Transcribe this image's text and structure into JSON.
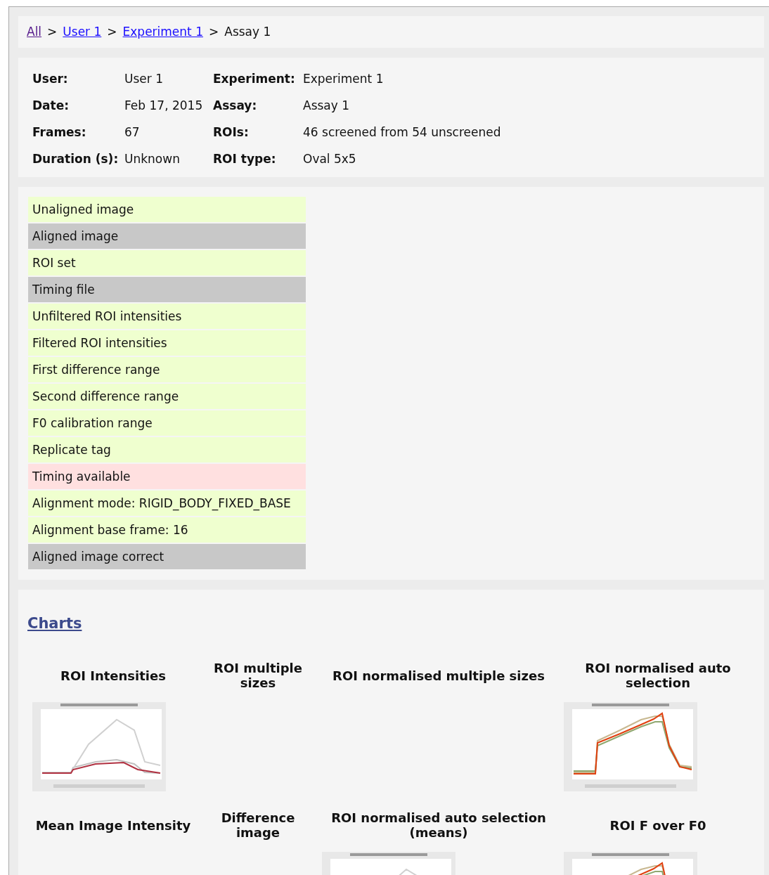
{
  "breadcrumb": [
    {
      "label": "All",
      "kind": "visited"
    },
    {
      "label": "User 1",
      "kind": "link"
    },
    {
      "label": "Experiment 1",
      "kind": "link"
    },
    {
      "label": "Assay 1",
      "kind": "current"
    }
  ],
  "breadcrumb_separator": ">",
  "info": [
    {
      "label": "User:",
      "value": "User 1"
    },
    {
      "label": "Experiment:",
      "value": "Experiment 1"
    },
    {
      "label": "Date:",
      "value": "Feb 17, 2015"
    },
    {
      "label": "Assay:",
      "value": "Assay 1"
    },
    {
      "label": "Frames:",
      "value": "67"
    },
    {
      "label": "ROIs:",
      "value": "46 screened from 54 unscreened"
    },
    {
      "label": "Duration (s):",
      "value": "Unknown"
    },
    {
      "label": "ROI type:",
      "value": "Oval 5x5"
    }
  ],
  "files": [
    {
      "label": "Unaligned image",
      "color": "#efffcf"
    },
    {
      "label": "Aligned image",
      "color": "#c8c8c8"
    },
    {
      "label": "ROI set",
      "color": "#efffcf"
    },
    {
      "label": "Timing file",
      "color": "#c8c8c8"
    },
    {
      "label": "Unfiltered ROI intensities",
      "color": "#efffcf"
    },
    {
      "label": "Filtered ROI intensities",
      "color": "#efffcf"
    },
    {
      "label": "First difference range",
      "color": "#efffcf"
    },
    {
      "label": "Second difference range",
      "color": "#efffcf"
    },
    {
      "label": "F0 calibration range",
      "color": "#efffcf"
    },
    {
      "label": "Replicate tag",
      "color": "#efffcf"
    },
    {
      "label": "Timing available",
      "color": "#ffe0e0"
    },
    {
      "label": "Alignment mode: RIGID_BODY_FIXED_BASE",
      "color": "#efffcf"
    },
    {
      "label": "Alignment base frame: 16",
      "color": "#efffcf"
    },
    {
      "label": "Aligned image correct",
      "color": "#c8c8c8"
    }
  ],
  "charts": {
    "heading": "Charts",
    "items": [
      {
        "title": "ROI Intensities"
      },
      {
        "title": "ROI multiple sizes"
      },
      {
        "title": "ROI normalised multiple sizes"
      },
      {
        "title": "ROI normalised auto selection"
      },
      {
        "title": "Mean Image Intensity"
      },
      {
        "title": "Difference image"
      },
      {
        "title": "ROI normalised auto selection (means)"
      },
      {
        "title": "ROI F over F0"
      }
    ]
  }
}
